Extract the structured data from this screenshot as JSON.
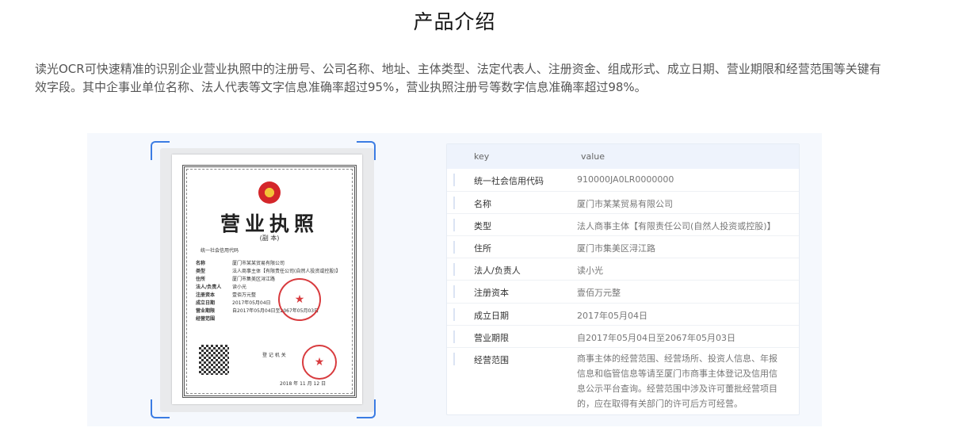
{
  "header": {
    "title": "产品介绍"
  },
  "intro": {
    "description": "读光OCR可快速精准的识别企业营业执照中的注册号、公司名称、地址、主体类型、法定代表人、注册资金、组成形式、成立日期、营业期限和经营范围等关键有效字段。其中企事业单位名称、法人代表等文字信息准确率超过95%，营业执照注册号等数字信息准确率超过98%。"
  },
  "license_image": {
    "title": "营业执照",
    "subtitle": "(副 本)",
    "code_label": "统一社会信用代码",
    "authority": "登 记 机 关",
    "date": "2018 年 11 月 12 日",
    "colors": {
      "seal": "#d4262a",
      "emblem": "#f3c338",
      "frame_accent": "#3b7ce3"
    }
  },
  "result_table": {
    "columns": {
      "key": "key",
      "value": "value"
    },
    "rows": [
      {
        "key": "统一社会信用代码",
        "value": "910000JA0LR0000000"
      },
      {
        "key": "名称",
        "value": "厦门市某某贸易有限公司"
      },
      {
        "key": "类型",
        "value": "法人商事主体【有限责任公司(自然人投资或控股)】"
      },
      {
        "key": "住所",
        "value": "厦门市集美区浔江路"
      },
      {
        "key": "法人/负责人",
        "value": "读小光"
      },
      {
        "key": "注册资本",
        "value": "壹佰万元整"
      },
      {
        "key": "成立日期",
        "value": "2017年05月04日"
      },
      {
        "key": "营业期限",
        "value": "自2017年05月04日至2067年05月03日"
      },
      {
        "key": "经营范围",
        "value": "商事主体的经营范围、经营场所、投资人信息、年报信息和临管信息等请至厦门市商事主体登记及信用信息公示平台查询。经营范围中涉及许可蕾批经营项目的，应在取得有关部门的许可后方可经营。"
      }
    ]
  }
}
